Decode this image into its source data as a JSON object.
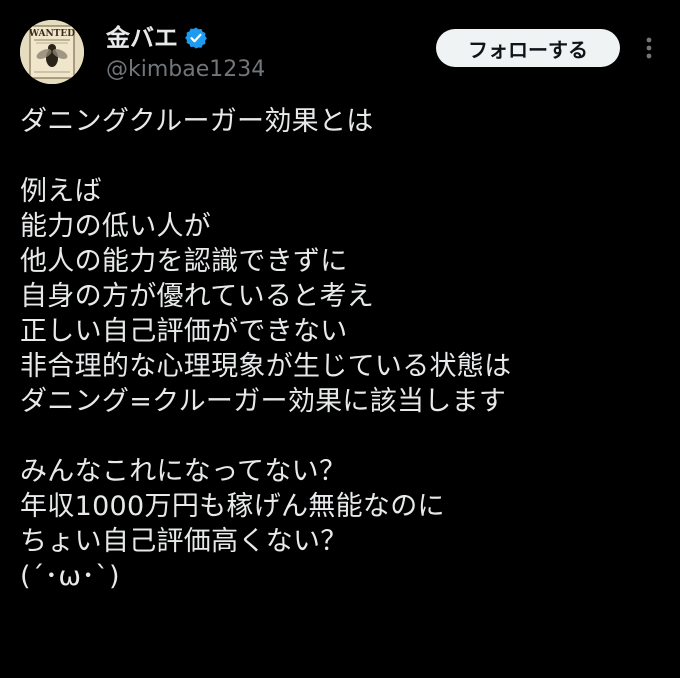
{
  "author": {
    "display_name": "金バエ",
    "handle": "@kimbae1234",
    "avatar_text": "WANTED",
    "verified_icon": "verified-badge-icon",
    "verified_color": "#1d9bf0"
  },
  "actions": {
    "follow_label": "フォローする",
    "more_icon": "more-vertical-icon"
  },
  "tweet": {
    "lines": [
      "ダニングクルーガー効果とは",
      "",
      "例えば",
      "能力の低い人が",
      "他人の能力を認識できずに",
      "自身の方が優れていると考え",
      "正しい自己評価ができない",
      "非合理的な心理現象が生じている状態は",
      "ダニング=クルーガー効果に該当します",
      "",
      "みんなこれになってない？",
      "年収1000万円も稼げん無能なのに",
      "ちょい自己評価高くない？",
      "(´･ω･`)"
    ]
  },
  "colors": {
    "background": "#000000",
    "text": "#e7e9ea",
    "secondary_text": "#71767b",
    "button_bg": "#eff3f4",
    "button_text": "#0f1419"
  }
}
